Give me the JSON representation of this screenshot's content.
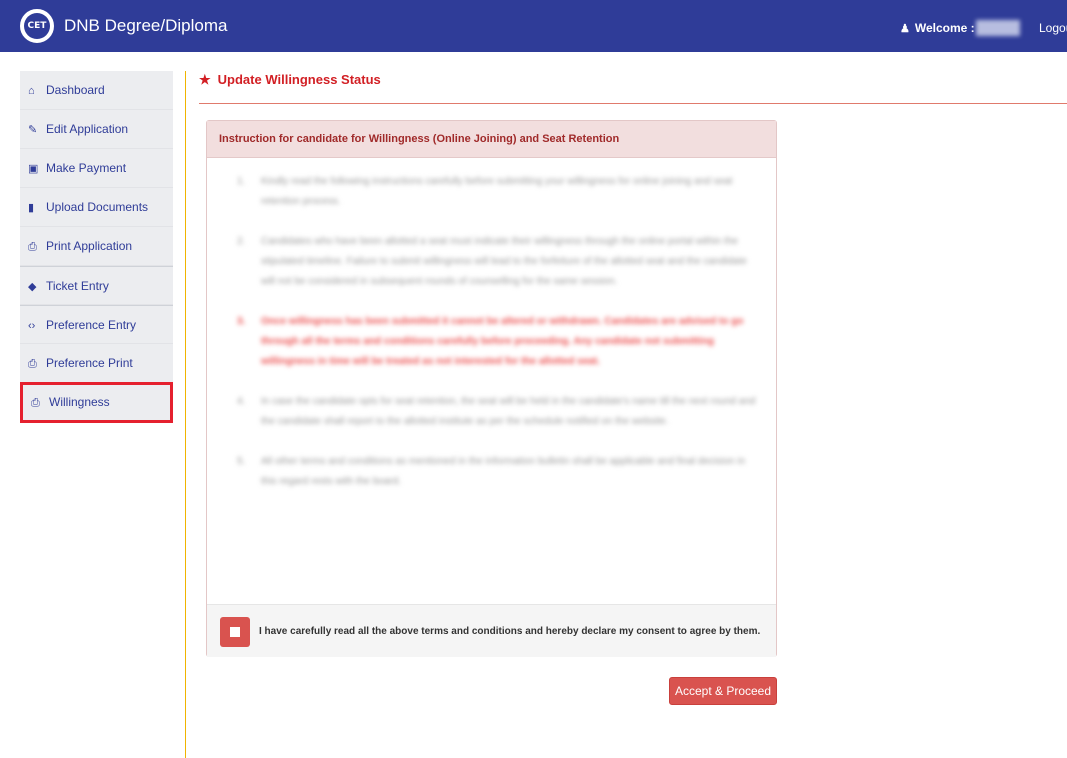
{
  "header": {
    "logo_text": "CET",
    "app_title": "DNB Degree/Diploma",
    "welcome_label": "Welcome :",
    "logout_label": "Logou"
  },
  "sidebar": {
    "items": [
      {
        "label": "Dashboard",
        "icon": "home-icon",
        "glyph": "⌂"
      },
      {
        "label": "Edit Application",
        "icon": "edit-icon",
        "glyph": "✎"
      },
      {
        "label": "Make Payment",
        "icon": "money-icon",
        "glyph": "▣"
      },
      {
        "label": "Upload Documents",
        "icon": "file-icon",
        "glyph": "▮"
      },
      {
        "label": "Print Application",
        "icon": "print-icon",
        "glyph": "⎙"
      },
      {
        "label": "Ticket Entry",
        "icon": "ticket-icon",
        "glyph": "◆"
      },
      {
        "label": "Preference Entry",
        "icon": "code-icon",
        "glyph": "‹›"
      },
      {
        "label": "Preference Print",
        "icon": "print-icon",
        "glyph": "⎙"
      },
      {
        "label": "Willingness",
        "icon": "print-icon",
        "glyph": "⎙"
      }
    ]
  },
  "main": {
    "page_title": "Update Willingness Status",
    "panel_heading": "Instruction for candidate for Willingness (Online Joining) and Seat Retention",
    "instructions": [
      {
        "num": "1.",
        "text": "Kindly read the following instructions carefully before submitting your willingness for online joining and seat retention process.",
        "highlight": false
      },
      {
        "num": "2.",
        "text": "Candidates who have been allotted a seat must indicate their willingness through the online portal within the stipulated timeline. Failure to submit willingness will lead to the forfeiture of the allotted seat and the candidate will not be considered in subsequent rounds of counselling for the same session.",
        "highlight": false
      },
      {
        "num": "3.",
        "text": "Once willingness has been submitted it cannot be altered or withdrawn. Candidates are advised to go through all the terms and conditions carefully before proceeding. Any candidate not submitting willingness in time will be treated as not interested for the allotted seat.",
        "highlight": true
      },
      {
        "num": "4.",
        "text": "In case the candidate opts for seat retention, the seat will be held in the candidate's name till the next round and the candidate shall report to the allotted institute as per the schedule notified on the website.",
        "highlight": false
      },
      {
        "num": "5.",
        "text": "All other terms and conditions as mentioned in the information bulletin shall be applicable and final decision in this regard rests with the board.",
        "highlight": false
      }
    ],
    "consent_text": "I have carefully read all the above terms and conditions and hereby declare my consent to agree by them.",
    "accept_label": "Accept & Proceed"
  }
}
